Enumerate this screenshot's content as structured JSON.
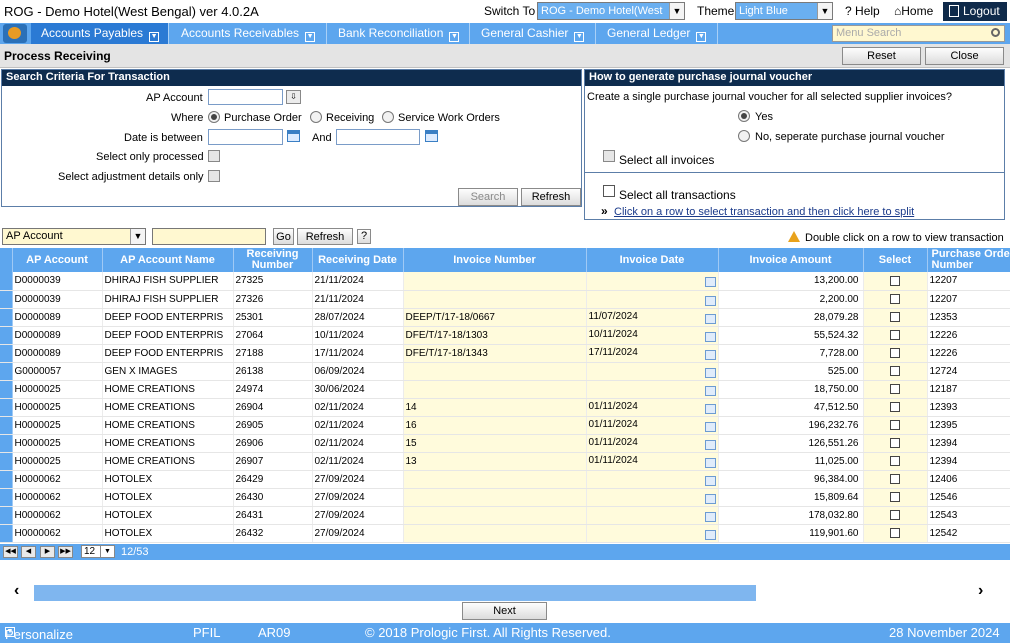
{
  "header": {
    "app_title": "ROG - Demo Hotel(West Bengal) ver 4.0.2A",
    "switch_label": "Switch To",
    "switch_value": "ROG - Demo Hotel(West",
    "theme_label": "Theme",
    "theme_value": "Light Blue",
    "help_label": "Help",
    "home_label": "Home",
    "logout_label": "Logout"
  },
  "menu": {
    "items": [
      "Accounts Payables",
      "Accounts Receivables",
      "Bank Reconciliation",
      "General Cashier",
      "General Ledger"
    ],
    "search_placeholder": "Menu Search"
  },
  "toolbar": {
    "page_title": "Process Receiving",
    "reset_label": "Reset",
    "close_label": "Close"
  },
  "search_panel": {
    "title": "Search Criteria For Transaction",
    "ap_account_label": "AP Account",
    "where_label": "Where",
    "where_options": [
      "Purchase Order",
      "Receiving",
      "Service Work Orders"
    ],
    "date_label": "Date is between",
    "and_label": "And",
    "only_processed_label": "Select only processed",
    "adjustment_label": "Select adjustment details only",
    "search_label": "Search",
    "refresh_label": "Refresh"
  },
  "journal_panel": {
    "title": "How to generate purchase journal voucher",
    "question": "Create a single purchase journal voucher for all selected supplier invoices?",
    "yes_label": "Yes",
    "no_label": "No, seperate purchase journal voucher",
    "select_all_invoices": "Select all invoices",
    "select_all_transactions": "Select all transactions",
    "split_link": "Click on a row to select transaction and then click here to split",
    "split_marker": "»"
  },
  "filter": {
    "field_value": "AP Account",
    "go_label": "Go",
    "refresh_label": "Refresh",
    "help_label": "?",
    "hint": "Double click on a row to view transaction"
  },
  "grid": {
    "columns": [
      "AP Account",
      "AP Account Name",
      "Receiving Number",
      "Receiving Date",
      "Invoice Number",
      "Invoice Date",
      "Invoice Amount",
      "Select",
      "Purchase Order Number"
    ],
    "rows": [
      [
        "D0000039",
        "DHIRAJ FISH SUPPLIER",
        "27325",
        "21/11/2024",
        "",
        "",
        "13,200.00",
        "12207"
      ],
      [
        "D0000039",
        "DHIRAJ FISH SUPPLIER",
        "27326",
        "21/11/2024",
        "",
        "",
        "2,200.00",
        "12207"
      ],
      [
        "D0000089",
        "DEEP FOOD ENTERPRIS",
        "25301",
        "28/07/2024",
        "DEEP/T/17-18/0667",
        "11/07/2024",
        "28,079.28",
        "12353"
      ],
      [
        "D0000089",
        "DEEP FOOD ENTERPRIS",
        "27064",
        "10/11/2024",
        "DFE/T/17-18/1303",
        "10/11/2024",
        "55,524.32",
        "12226"
      ],
      [
        "D0000089",
        "DEEP FOOD ENTERPRIS",
        "27188",
        "17/11/2024",
        "DFE/T/17-18/1343",
        "17/11/2024",
        "7,728.00",
        "12226"
      ],
      [
        "G0000057",
        "GEN X IMAGES",
        "26138",
        "06/09/2024",
        "",
        "",
        "525.00",
        "12724"
      ],
      [
        "H0000025",
        "HOME CREATIONS",
        "24974",
        "30/06/2024",
        "",
        "",
        "18,750.00",
        "12187"
      ],
      [
        "H0000025",
        "HOME CREATIONS",
        "26904",
        "02/11/2024",
        "14",
        "01/11/2024",
        "47,512.50",
        "12393"
      ],
      [
        "H0000025",
        "HOME CREATIONS",
        "26905",
        "02/11/2024",
        "16",
        "01/11/2024",
        "196,232.76",
        "12395"
      ],
      [
        "H0000025",
        "HOME CREATIONS",
        "26906",
        "02/11/2024",
        "15",
        "01/11/2024",
        "126,551.26",
        "12394"
      ],
      [
        "H0000025",
        "HOME CREATIONS",
        "26907",
        "02/11/2024",
        "13",
        "01/11/2024",
        "11,025.00",
        "12394"
      ],
      [
        "H0000062",
        "HOTOLEX",
        "26429",
        "27/09/2024",
        "",
        "",
        "96,384.00",
        "12406"
      ],
      [
        "H0000062",
        "HOTOLEX",
        "26430",
        "27/09/2024",
        "",
        "",
        "15,809.64",
        "12546"
      ],
      [
        "H0000062",
        "HOTOLEX",
        "26431",
        "27/09/2024",
        "",
        "",
        "178,032.80",
        "12543"
      ],
      [
        "H0000062",
        "HOTOLEX",
        "26432",
        "27/09/2024",
        "",
        "",
        "119,901.60",
        "12542"
      ]
    ]
  },
  "pager": {
    "page_size": "12",
    "info": "12/53"
  },
  "next_label": "Next",
  "footer": {
    "personalize": "Personalize",
    "module": "PFIL",
    "screen": "AR09",
    "copyright": "© 2018 Prologic First. All Rights Reserved.",
    "date": "28 November 2024"
  }
}
